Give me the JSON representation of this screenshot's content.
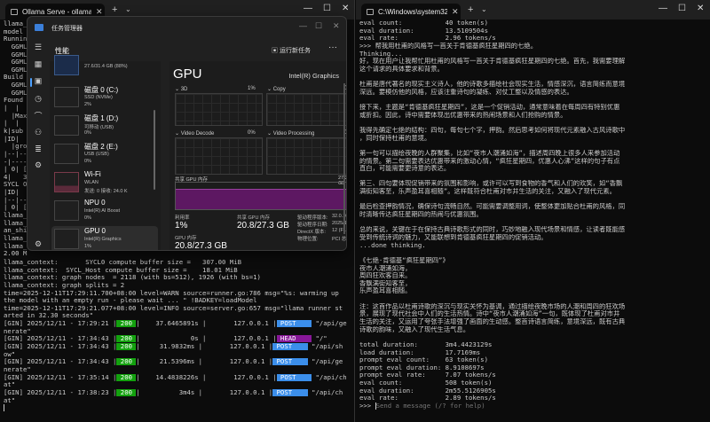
{
  "left_window": {
    "tab_title": "Ollama Serve - ollama-serve.b",
    "behind_lines": [
      "llama_",
      "model ",
      "Running",
      "  GGML_",
      "  GGML_",
      "  GGML_",
      "  GGML_",
      "Build ",
      "  GGML_",
      "  GGML_",
      "Found ",
      "|  |",
      "  |Max",
      "|  |",
      "k|sub",
      "|ID|",
      "  |grou",
      "|--|--",
      "-|----",
      "| 0| [",
      "4|   3",
      "SYCL O",
      "|ID|",
      "|--|--",
      "| 0| [",
      "llama_",
      "llama_",
      "an_shi",
      "llama_",
      "llama_",
      "2.00 M"
    ],
    "log_lines": [
      "llama_context:       SYCL0 compute buffer size =   307.00 MiB",
      "llama_context:  SYCL_Host compute buffer size =    18.01 MiB",
      "llama_context: graph nodes  = 2118 (with bs=512), 1926 (with bs=1)",
      "llama_context: graph splits = 2",
      "time=2025-12-11T17:29:11.700+08:00 level=WARN source=runner.go:786 msg=\"%s: warming up",
      "the model with an empty run - please wait ... \" !BADKEY=loadModel",
      "time=2025-12-11T17:29:21.077+08:00 level=INFO source=server.go:657 msg=\"llama runner st",
      "arted in 32.30 seconds\""
    ],
    "gin": [
      {
        "prefix": "[GIN] 2025/12/11 - 17:29:21 |",
        "status": " 200 ",
        "latency": "|    37.6465891s |       127.0.0.1 |",
        "method": " POST    ",
        "path": " \"/api/ge",
        "cont": "nerate\"",
        "method_color": "#3b8eea"
      },
      {
        "prefix": "[GIN] 2025/12/11 - 17:34:43 |",
        "status": " 200 ",
        "latency": "|             0s |       127.0.0.1 |",
        "method": " HEAD    ",
        "path": " \"/\"",
        "cont": null,
        "method_color": "#881798"
      },
      {
        "prefix": "[GIN] 2025/12/11 - 17:34:43 |",
        "status": " 200 ",
        "latency": "|     31.9832ms |       127.0.0.1 |",
        "method": " POST    ",
        "path": " \"/api/sh",
        "cont": "ow\"",
        "method_color": "#3b8eea"
      },
      {
        "prefix": "[GIN] 2025/12/11 - 17:34:43 |",
        "status": " 200 ",
        "latency": "|     21.5396ms |       127.0.0.1 |",
        "method": " POST    ",
        "path": " \"/api/ge",
        "cont": "nerate\"",
        "method_color": "#3b8eea"
      },
      {
        "prefix": "[GIN] 2025/12/11 - 17:35:14 |",
        "status": " 200 ",
        "latency": "|    14.4838226s |       127.0.0.1 |",
        "method": " POST    ",
        "path": " \"/api/ch",
        "cont": "at\"",
        "method_color": "#3b8eea"
      },
      {
        "prefix": "[GIN] 2025/12/11 - 17:38:23 |",
        "status": " 200 ",
        "latency": "|          3m4s |       127.0.0.1 |",
        "method": " POST    ",
        "path": " \"/api/ch",
        "cont": "at\"",
        "method_color": "#3b8eea"
      }
    ]
  },
  "task_manager": {
    "title": "任务管理器",
    "section": "性能",
    "run_new_task": "运行新任务",
    "more": "···",
    "devices": [
      {
        "name": "",
        "sub": "27.6/31.4 GB (88%)",
        "val": ""
      },
      {
        "name": "磁盘 0 (C:)",
        "sub": "SSD (NVMe)",
        "val": "2%"
      },
      {
        "name": "磁盘 1 (D:)",
        "sub": "可移动 (USB)",
        "val": "0%"
      },
      {
        "name": "磁盘 2 (E:)",
        "sub": "USB (USB)",
        "val": "0%"
      },
      {
        "name": "Wi-Fi",
        "sub": "WLAN",
        "val": "发送: 0 接收: 24.0 K"
      },
      {
        "name": "NPU 0",
        "sub": "Intel(R) AI Boost",
        "val": "0%"
      },
      {
        "name": "GPU 0",
        "sub": "Intel(R) Graphics",
        "val": "1%"
      },
      {
        "name": "GPU 1",
        "sub": "",
        "val": ""
      }
    ],
    "selected_device": "GPU 0",
    "detail": {
      "title": "GPU",
      "adapter": "Intel(R) Graphics",
      "graphs": [
        {
          "label": "3D",
          "value": "1%"
        },
        {
          "label": "Copy",
          "value": "0%"
        },
        {
          "label": "Video Decode",
          "value": "0%"
        },
        {
          "label": "Video Processing",
          "value": "0%"
        }
      ],
      "shared_mem_label": "共享 GPU 内存",
      "shared_mem_max": "27.3 GB",
      "shared_mem_fraction": 0.76,
      "utilization_label": "利用率",
      "utilization": "1%",
      "shared_label": "共享 GPU 内存",
      "shared_value": "20.8/27.3 GB",
      "gpu_mem_label": "GPU 内存",
      "gpu_mem_value": "20.8/27.3 GB",
      "info": [
        {
          "k": "驱动程序版本:",
          "v": "32.0.10..."
        },
        {
          "k": "驱动程序日期:",
          "v": "2025/1..."
        },
        {
          "k": "DirectX 版本:",
          "v": "12 (FL ..."
        },
        {
          "k": "物理位置:",
          "v": "PCI 总..."
        }
      ]
    }
  },
  "right_window": {
    "tab_title": "C:\\Windows\\system32\\cmd.ex",
    "lines": [
      "eval count:           40 token(s)",
      "eval duration:        13.5109504s",
      "eval rate:            2.96 tokens/s",
      ">>> 帮我用杜甫的风格写一首关于肯德基疯狂星期四的七绝。",
      "Thinking...",
      "好，现在用户让我帮忙用杜甫的风格写一首关于肯德基疯狂星期四的七绝。首先，我需要理解",
      "这个请求的具体要求和背景。",
      "",
      "杜甫是唐代著名的现实主义诗人，他的诗歌多描绘社会现实生活，情感深沉，语言简练而意境",
      "深远。要模仿他的风格，应该注重诗句的凝练、对仗工整以及情感的表达。",
      "",
      "接下来，主题是“肯德基疯狂星期四”，这是一个促销活动，通常意味着在每周四有特别优惠",
      "或折扣。因此，诗中需要体现出优惠带来的热闹场景和人们抢购的情景。",
      "",
      "我得先确定七绝的结构：四句，每句七个字，押韵。然后思考如何将现代元素融入古风诗歌中",
      "，同时保持杜甫的意境。",
      "",
      "第一句可以描绘夜晚的人群聚集，比如“夜市人潮涌如海”，描述周四晚上很多人来参加活动",
      "的情景。第二句需要表达优惠带来的激动心情，“疯狂星期四，优惠人心沸”这样的句子有点",
      "直白，可能需要更诗意的表达。",
      "",
      "第三、四句要体现促销带来的氛围和影响，或许可以写到食物的香气和人们的欢笑，如“香飘",
      "满街知客至，乐声盈耳喜相随”。这样既符合杜甫对市井生活的关注，又融入了现代元素。",
      "",
      "最后检查押韵情况，确保诗句流畅自然。可能需要调整用词，使整体更加贴合杜甫的风格，同",
      "时清晰传达疯狂星期四的热闹与优惠氛围。",
      "",
      "总的来说，关键在于在保持古典诗歌形式的同时，巧妙地融入现代场景和情感，让读者既能感",
      "受到传统诗词的魅力，又能联想到肯德基疯狂星期四的促销活动。",
      "...done thinking.",
      "",
      "《七绝·肯德基“疯狂星期四”》",
      "夜市人潮涌如海，",
      "周四狂欢客自来。",
      "香飘满街知客至，",
      "乐声盈耳喜相随。",
      "",
      "注：这首作品以杜甫诗歌的深沉与现实关怀为基调，通过描绘夜晚市场的人潮和周四的狂欢场",
      "景，展现了现代社会中人们的生活热情。诗中“夜市人潮涌如海”一句，既体现了杜甫对市井",
      "生活的关注，又运用了夸张手法增强了画面的生动感。整首诗语言简练，意境深远，既有古典",
      "诗歌的韵味，又融入了现代生活气息。",
      "",
      "total duration:       3m4.4423129s",
      "load duration:        17.7169ms",
      "prompt eval count:    63 token(s)",
      "prompt eval duration: 8.9108697s",
      "prompt eval rate:     7.07 tokens/s",
      "eval count:           508 token(s)",
      "eval duration:        2m55.5126905s",
      "eval rate:            2.89 tokens/s"
    ],
    "prompt": ">>> ",
    "input_placeholder": "Send a message (/? for help)"
  }
}
